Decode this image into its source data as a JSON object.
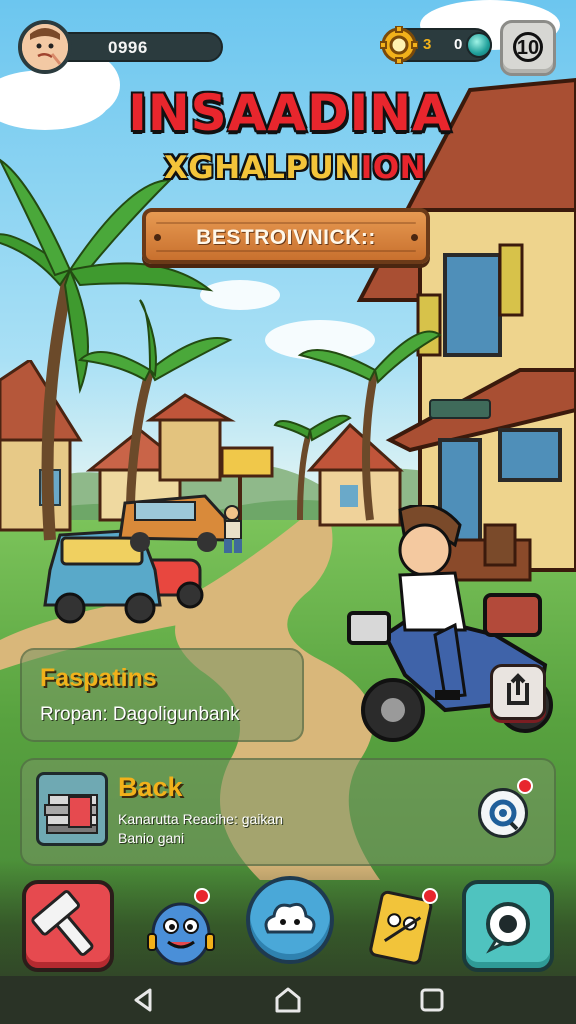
{
  "hud": {
    "score": "0996",
    "coins": "3",
    "gems": "0",
    "level": "10"
  },
  "title": {
    "main": "INSAADINA",
    "sub_part1": "X",
    "sub_part2": "GHALPUN",
    "sub_part3": "ION",
    "banner": "BESTROIVNICK::"
  },
  "panels": {
    "info": {
      "title": "Faspatins",
      "text": "Rropan: Dagoligunbank"
    },
    "mission": {
      "title": "Back",
      "text_line1": "Kanarutta Reacihe: gaikan",
      "text_line2": "Banio gani"
    }
  },
  "colors": {
    "accent_red": "#e8262d",
    "accent_yellow": "#f2b11a",
    "build_button": "#e64a4f",
    "home_button": "#4aa8d8",
    "map_button": "#4fc3bf"
  },
  "icons": {
    "avatar": "player-face",
    "coin": "gold-gear-coin",
    "gem": "teal-gem",
    "level": "level-badge",
    "build": "hammer",
    "character": "blue-monster",
    "home": "cloud-creature",
    "quest": "quest-card",
    "map": "map-pin",
    "share": "share",
    "search": "search"
  }
}
